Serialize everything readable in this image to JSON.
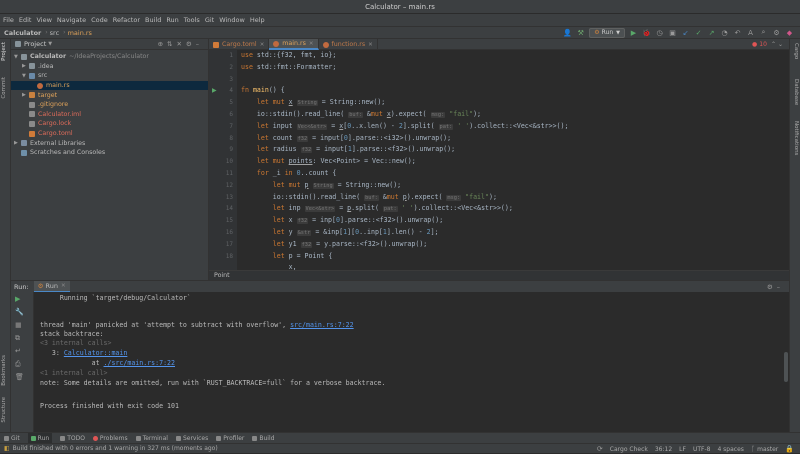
{
  "window": {
    "title": "Calculator – main.rs"
  },
  "menu": [
    "File",
    "Edit",
    "View",
    "Navigate",
    "Code",
    "Refactor",
    "Build",
    "Run",
    "Tools",
    "Git",
    "Window",
    "Help"
  ],
  "navbar": {
    "crumbs": [
      "Calculator",
      "src",
      "main.rs"
    ],
    "run_config": "Run"
  },
  "project": {
    "header": "Project",
    "tree": [
      {
        "label": "Calculator",
        "suffix": "~/IdeaProjects/Calculator",
        "depth": 0,
        "icon": "folder",
        "expanded": true
      },
      {
        "label": ".idea",
        "depth": 1,
        "icon": "folder",
        "expanded": false
      },
      {
        "label": "src",
        "depth": 1,
        "icon": "folder",
        "expanded": true
      },
      {
        "label": "main.rs",
        "depth": 2,
        "icon": "rust-file",
        "selected": true,
        "color": "orange"
      },
      {
        "label": "target",
        "depth": 1,
        "icon": "folder-orange",
        "expanded": false,
        "color": "orange"
      },
      {
        "label": ".gitignore",
        "depth": 1,
        "icon": "file",
        "color": "orange"
      },
      {
        "label": "Calculator.iml",
        "depth": 1,
        "icon": "file",
        "color": "red"
      },
      {
        "label": "Cargo.lock",
        "depth": 1,
        "icon": "file",
        "color": "red"
      },
      {
        "label": "Cargo.toml",
        "depth": 1,
        "icon": "toml-file",
        "color": "red"
      },
      {
        "label": "External Libraries",
        "depth": 0,
        "icon": "library",
        "expanded": false
      },
      {
        "label": "Scratches and Consoles",
        "depth": 0,
        "icon": "scratch"
      }
    ]
  },
  "editor": {
    "tabs": [
      {
        "label": "Cargo.toml",
        "active": false
      },
      {
        "label": "main.rs",
        "active": true
      },
      {
        "label": "function.rs",
        "active": false
      }
    ],
    "error_count": "10",
    "breadcrumb": "Point",
    "line_numbers": [
      "1",
      "2",
      "3",
      "4",
      "5",
      "6",
      "7",
      "8",
      "9",
      "10",
      "11",
      "12",
      "13",
      "14",
      "15",
      "16",
      "17",
      "18"
    ],
    "hints": {
      "string": "String",
      "bufstr": "buf:",
      "mag": "msg:",
      "pat": "pat:",
      "vecstr": "Vec<&str>",
      "f32": "f32",
      "str": "&str"
    }
  },
  "run": {
    "label": "Run:",
    "tab": "Run",
    "lines": [
      "     Running `target/debug/Calculator`",
      "",
      "thread 'main' panicked at 'attempt to subtract with overflow', ",
      "stack backtrace:",
      "<3 internal calls>",
      "   3: ",
      "             at ",
      "<1 internal call>",
      "note: Some details are omitted, run with `RUST_BACKTRACE=full` for a verbose backtrace.",
      "",
      "Process finished with exit code 101"
    ],
    "links": {
      "panic": "src/main.rs:7:22",
      "frame": "Calculator::main",
      "frame_loc": "./src/main.rs:7:22"
    }
  },
  "bottom_tabs": [
    "Git",
    "Run",
    "TODO",
    "Problems",
    "Terminal",
    "Services",
    "Profiler",
    "Build"
  ],
  "status": {
    "message": "Build finished with 0 errors and 1 warning in 327 ms (moments ago)",
    "cargo": "Cargo Check",
    "position": "36:12",
    "line_sep": "LF",
    "encoding": "UTF-8",
    "indent": "4 spaces",
    "branch": "master"
  },
  "side_labels": {
    "left": [
      "Project",
      "Commit",
      "Bookmarks",
      "Structure"
    ],
    "right": [
      "Cargo",
      "Database",
      "Notifications"
    ]
  }
}
